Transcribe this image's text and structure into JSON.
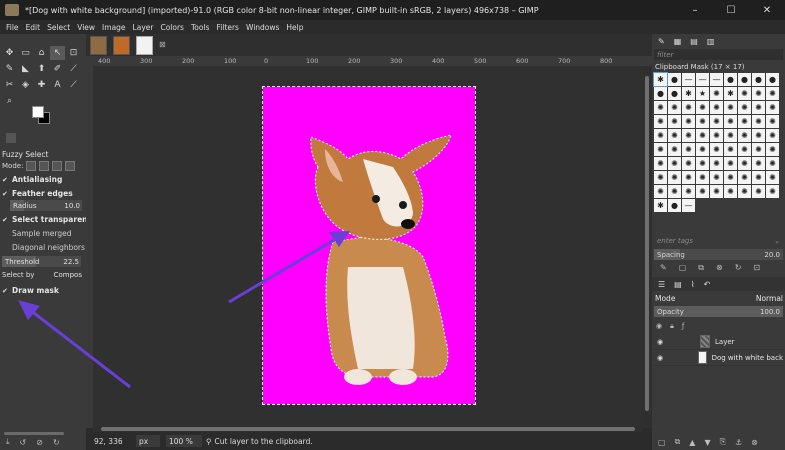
{
  "window": {
    "title": "*[Dog with white background] (imported)-91.0 (RGB color 8-bit non-linear integer, GIMP built-in sRGB, 2 layers) 496x738 – GIMP",
    "minimize": "–",
    "maximize": "☐",
    "close": "✕"
  },
  "menu": [
    "File",
    "Edit",
    "Select",
    "View",
    "Image",
    "Layer",
    "Colors",
    "Tools",
    "Filters",
    "Windows",
    "Help"
  ],
  "image_tabs": {
    "close_glyph": "⊠"
  },
  "toolbox": {
    "tools": [
      "✥",
      "▭",
      "⌂",
      "↖",
      "⊡",
      "✎",
      "◣",
      "⬆",
      "✐",
      "⟋",
      "✂",
      "◈",
      "✚",
      "A",
      "⟋",
      "♙",
      "◉",
      "✎",
      "✎",
      "✎",
      "⌕"
    ],
    "options_title": "Fuzzy Select",
    "mode_label": "Mode:",
    "antialiasing": "Antialiasing",
    "feather_edges": "Feather edges",
    "radius_label": "Radius",
    "radius_value": "10.0",
    "select_transparent": "Select transparent",
    "sample_merged": "Sample merged",
    "diagonal_neighbors": "Diagonal neighbors",
    "threshold_label": "Threshold",
    "threshold_value": "22.5",
    "select_by_label": "Select by",
    "select_by_value": "Compos",
    "draw_mask": "Draw mask",
    "check": "✔"
  },
  "ruler": {
    "ticks": [
      "400",
      "300",
      "200",
      "100",
      "0",
      "100",
      "200",
      "300",
      "400",
      "500",
      "600",
      "700",
      "800"
    ]
  },
  "statusbar": {
    "coords": "92, 336",
    "unit": "px",
    "zoom": "100 %",
    "message": "Cut layer to the clipboard."
  },
  "dock": {
    "filter_placeholder": "filter",
    "brush_title": "Clipboard Mask (17 × 17)",
    "tags_placeholder": "enter tags",
    "spacing_label": "Spacing",
    "spacing_value": "20.0",
    "spacing_fraction": 0.2,
    "mode_label": "Mode",
    "mode_value": "Normal",
    "opacity_label": "Opacity",
    "opacity_value": "100.0",
    "layers": [
      {
        "name": "Layer",
        "thumb": "mask"
      },
      {
        "name": "Dog with white back",
        "thumb": "dog"
      }
    ]
  },
  "colors": {
    "canvas_bg": "#ff00ff",
    "annotation_arrow": "#6a3fd6"
  }
}
